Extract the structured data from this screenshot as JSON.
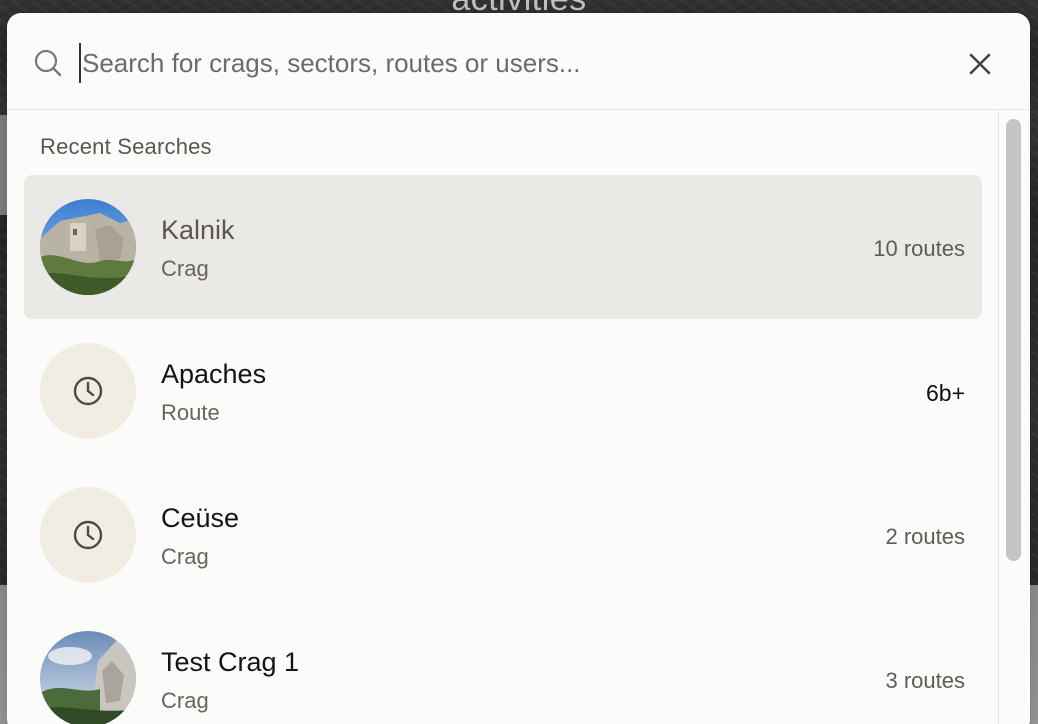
{
  "background": {
    "title": "activities"
  },
  "search": {
    "placeholder": "Search for crags, sectors, routes or users...",
    "value": ""
  },
  "recent": {
    "heading": "Recent Searches",
    "items": [
      {
        "name": "Kalnik",
        "type": "Crag",
        "meta": "10 routes",
        "avatar": "photo",
        "selected": true
      },
      {
        "name": "Apaches",
        "type": "Route",
        "meta": "6b+",
        "avatar": "clock-icon",
        "selected": false
      },
      {
        "name": "Ceüse",
        "type": "Crag",
        "meta": "2 routes",
        "avatar": "clock-icon",
        "selected": false
      },
      {
        "name": "Test Crag 1",
        "type": "Crag",
        "meta": "3 routes",
        "avatar": "photo",
        "selected": false
      }
    ]
  },
  "colors": {
    "modal_bg": "#fbfbfa",
    "selected_row": "#eae9e5",
    "placeholder_avatar": "#f2ede3"
  }
}
